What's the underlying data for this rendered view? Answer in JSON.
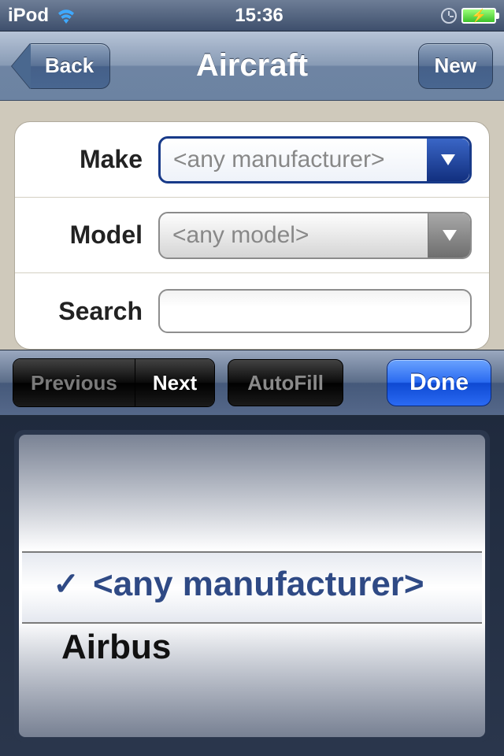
{
  "status": {
    "carrier": "iPod",
    "time": "15:36"
  },
  "nav": {
    "back": "Back",
    "title": "Aircraft",
    "new": "New"
  },
  "form": {
    "make_label": "Make",
    "make_value": "<any manufacturer>",
    "model_label": "Model",
    "model_value": "<any model>",
    "search_label": "Search",
    "search_value": ""
  },
  "accessory": {
    "previous": "Previous",
    "next": "Next",
    "autofill": "AutoFill",
    "done": "Done"
  },
  "picker": {
    "selected": "<any manufacturer>",
    "next": "Airbus"
  }
}
